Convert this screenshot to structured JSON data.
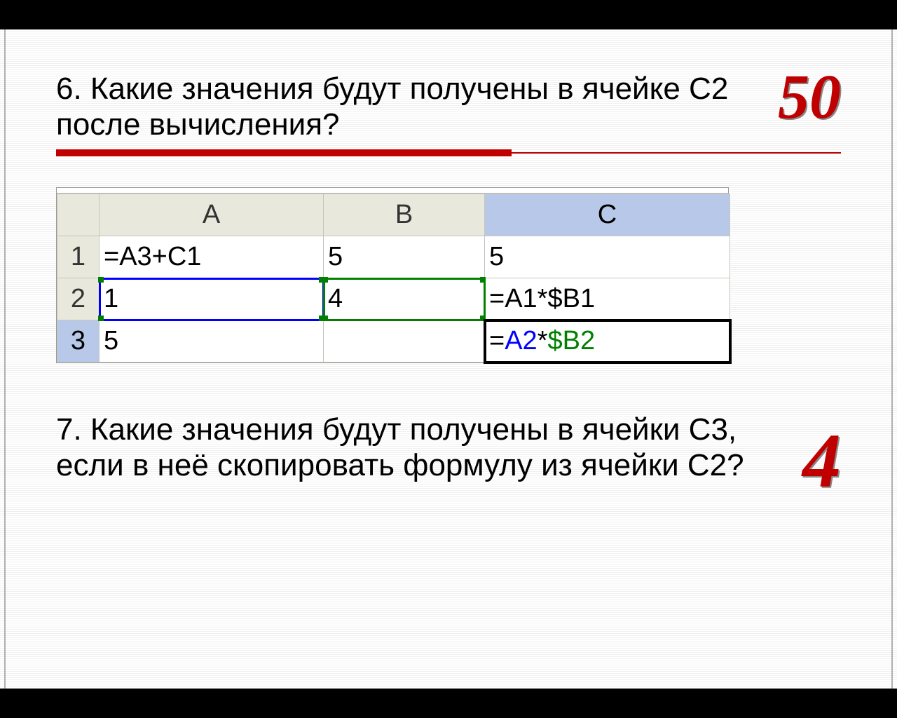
{
  "q6": {
    "text": "6. Какие значения будут получены в ячейке С2 после вычисления?",
    "answer": "50"
  },
  "q7": {
    "text": "7. Какие значения будут получены в ячейки С3, если в неё скопировать формулу из ячейки С2?",
    "answer": "4"
  },
  "sheet": {
    "cols": [
      "A",
      "B",
      "C"
    ],
    "rows": [
      "1",
      "2",
      "3"
    ],
    "cells": {
      "A1": "=A3+C1",
      "B1": "5",
      "C1": "5",
      "A2": "1",
      "B2": "4",
      "C2": "=A1*$B1",
      "A3": "5",
      "B3": "",
      "C3": "=A2*$B2"
    },
    "c3_formula": {
      "ref1": "A2",
      "op": "*",
      "ref2": "$B2"
    },
    "selected_cell": "C3",
    "blue_range": "A2",
    "green_range": "B2"
  }
}
